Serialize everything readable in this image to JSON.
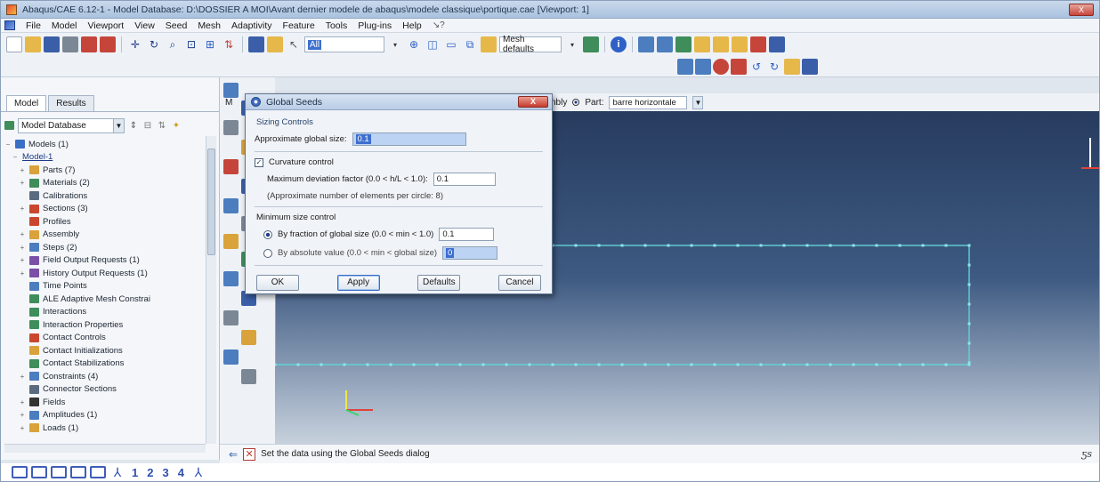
{
  "window": {
    "title": "Abaqus/CAE 6.12-1 - Model Database: D:\\DOSSIER A MOI\\Avant dernier modele de abaqus\\modele classique\\portique.cae [Viewport: 1]",
    "close_label": "X"
  },
  "menu": [
    "File",
    "Model",
    "Viewport",
    "View",
    "Seed",
    "Mesh",
    "Adaptivity",
    "Feature",
    "Tools",
    "Plug-ins",
    "Help",
    "↘?"
  ],
  "toolbar": {
    "filter_value": "All",
    "mesh_defaults": "Mesh defaults"
  },
  "left_panel": {
    "tabs": [
      "Model",
      "Results"
    ],
    "tree_selector": "Model Database",
    "tree": [
      {
        "label": "Models (1)",
        "level": 0,
        "expander": "−",
        "icon": "models-icon",
        "color": "#3b6fc4"
      },
      {
        "label": "Model-1",
        "level": 1,
        "expander": "−",
        "icon": "",
        "color": "#1b3a8a"
      },
      {
        "label": "Parts (7)",
        "level": 2,
        "expander": "+",
        "icon": "parts-icon",
        "color": "#d9a23a"
      },
      {
        "label": "Materials (2)",
        "level": 2,
        "expander": "+",
        "icon": "materials-icon",
        "color": "#3f8d5a"
      },
      {
        "label": "Calibrations",
        "level": 2,
        "expander": "",
        "icon": "calibrations-icon",
        "color": "#5a6b80"
      },
      {
        "label": "Sections (3)",
        "level": 2,
        "expander": "+",
        "icon": "sections-icon",
        "color": "#c9472f"
      },
      {
        "label": "Profiles",
        "level": 2,
        "expander": "",
        "icon": "profiles-icon",
        "color": "#c9472f"
      },
      {
        "label": "Assembly",
        "level": 2,
        "expander": "+",
        "icon": "assembly-icon",
        "color": "#d9a23a"
      },
      {
        "label": "Steps (2)",
        "level": 2,
        "expander": "+",
        "icon": "steps-icon",
        "color": "#4b7dbf"
      },
      {
        "label": "Field Output Requests (1)",
        "level": 2,
        "expander": "+",
        "icon": "field-output-icon",
        "color": "#7b4fa8"
      },
      {
        "label": "History Output Requests (1)",
        "level": 2,
        "expander": "+",
        "icon": "history-output-icon",
        "color": "#7b4fa8"
      },
      {
        "label": "Time Points",
        "level": 2,
        "expander": "",
        "icon": "time-points-icon",
        "color": "#4b7dbf"
      },
      {
        "label": "ALE Adaptive Mesh Constrai",
        "level": 2,
        "expander": "",
        "icon": "ale-mesh-icon",
        "color": "#3f8d5a"
      },
      {
        "label": "Interactions",
        "level": 2,
        "expander": "",
        "icon": "interactions-icon",
        "color": "#3f8d5a"
      },
      {
        "label": "Interaction Properties",
        "level": 2,
        "expander": "",
        "icon": "interaction-properties-icon",
        "color": "#3f8d5a"
      },
      {
        "label": "Contact Controls",
        "level": 2,
        "expander": "",
        "icon": "contact-controls-icon",
        "color": "#c9472f"
      },
      {
        "label": "Contact Initializations",
        "level": 2,
        "expander": "",
        "icon": "contact-init-icon",
        "color": "#d9a23a"
      },
      {
        "label": "Contact Stabilizations",
        "level": 2,
        "expander": "",
        "icon": "contact-stab-icon",
        "color": "#3f8d5a"
      },
      {
        "label": "Constraints (4)",
        "level": 2,
        "expander": "+",
        "icon": "constraints-icon",
        "color": "#4b7dbf"
      },
      {
        "label": "Connector Sections",
        "level": 2,
        "expander": "",
        "icon": "connector-icon",
        "color": "#5a6b80"
      },
      {
        "label": "Fields",
        "level": 2,
        "expander": "+",
        "icon": "fields-icon",
        "color": "#333333"
      },
      {
        "label": "Amplitudes (1)",
        "level": 2,
        "expander": "+",
        "icon": "amplitudes-icon",
        "color": "#4b7dbf"
      },
      {
        "label": "Loads (1)",
        "level": 2,
        "expander": "+",
        "icon": "loads-icon",
        "color": "#d9a23a"
      }
    ]
  },
  "context": {
    "module_label": "M",
    "object_label": "nbly",
    "part_label": "Part:",
    "part_value": "barre horizontale"
  },
  "dialog": {
    "title": "Global Seeds",
    "close_label": "X",
    "group_label": "Sizing Controls",
    "approx_size_label": "Approximate global size:",
    "approx_size_value": "0.1",
    "curvature_label": "Curvature control",
    "curvature_checked": true,
    "deviation_label": "Maximum deviation factor (0.0 < h/L < 1.0):",
    "deviation_value": "0.1",
    "deviation_hint": "(Approximate number of elements per circle: 8)",
    "min_size_label": "Minimum size control",
    "fraction_label": "By fraction of global size  (0.0 < min < 1.0)",
    "fraction_value": "0.1",
    "absolute_label": "By absolute value  (0.0 < min < global size)",
    "absolute_value": "0",
    "buttons": {
      "ok": "OK",
      "apply": "Apply",
      "defaults": "Defaults",
      "cancel": "Cancel"
    }
  },
  "prompt": {
    "text": "Set the data using the Global Seeds dialog"
  },
  "bottom": {
    "numbers": [
      "1",
      "2",
      "3",
      "4"
    ]
  },
  "colors": {
    "mesh_line": "#5fd3d6",
    "seed": "#8de6ea",
    "viewport_top": "#273c5f",
    "viewport_bottom": "#c7d1dd"
  }
}
